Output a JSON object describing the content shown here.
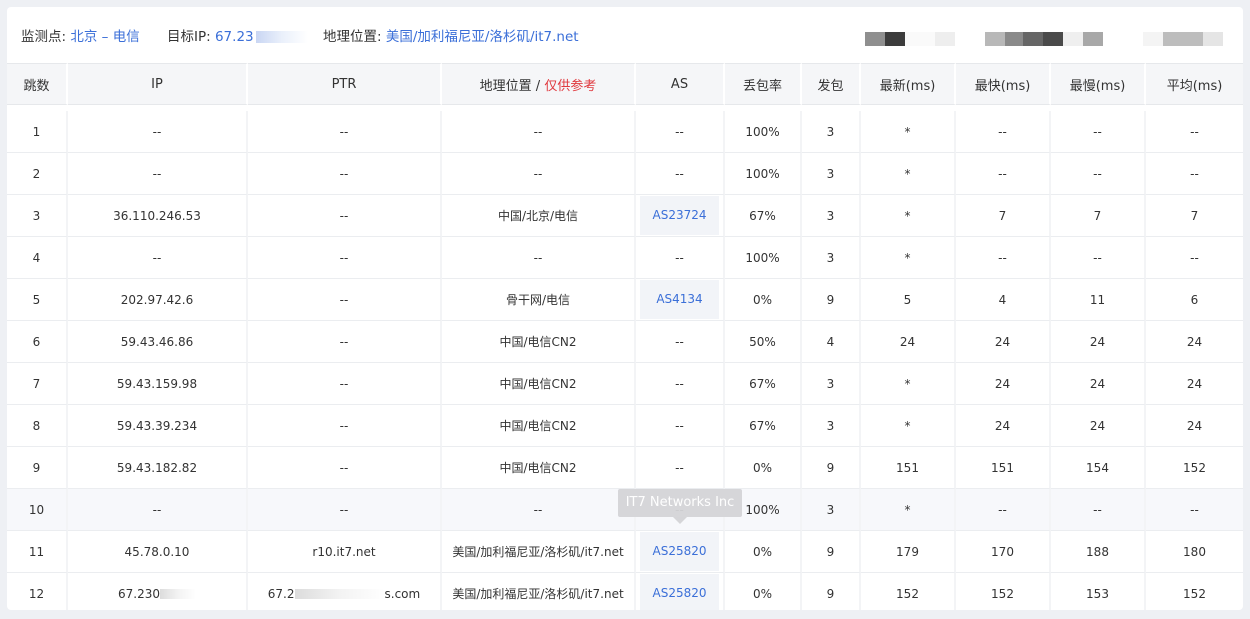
{
  "info": {
    "monitor_label": "监测点:",
    "monitor_value": "北京 – 电信",
    "target_label": "目标IP:",
    "target_value": "67.23",
    "geo_label": "地理位置:",
    "geo_value": "美国/加利福尼亚/洛杉矶/it7.net"
  },
  "table": {
    "headers": {
      "hop": "跳数",
      "ip": "IP",
      "ptr": "PTR",
      "geo": "地理位置",
      "geo_sep": " / ",
      "geo_note": "仅供参考",
      "as": "AS",
      "loss": "丢包率",
      "sent": "发包",
      "latest": "最新(ms)",
      "best": "最快(ms)",
      "worst": "最慢(ms)",
      "avg": "平均(ms)"
    },
    "rows": [
      {
        "hop": "1",
        "ip": "--",
        "ptr": "--",
        "geo": "--",
        "as": "--",
        "loss": "100%",
        "sent": "3",
        "latest": "*",
        "best": "--",
        "worst": "--",
        "avg": "--"
      },
      {
        "hop": "2",
        "ip": "--",
        "ptr": "--",
        "geo": "--",
        "as": "--",
        "loss": "100%",
        "sent": "3",
        "latest": "*",
        "best": "--",
        "worst": "--",
        "avg": "--"
      },
      {
        "hop": "3",
        "ip": "36.110.246.53",
        "ptr": "--",
        "geo": "中国/北京/电信",
        "as": "AS23724",
        "loss": "67%",
        "sent": "3",
        "latest": "*",
        "best": "7",
        "worst": "7",
        "avg": "7"
      },
      {
        "hop": "4",
        "ip": "--",
        "ptr": "--",
        "geo": "--",
        "as": "--",
        "loss": "100%",
        "sent": "3",
        "latest": "*",
        "best": "--",
        "worst": "--",
        "avg": "--"
      },
      {
        "hop": "5",
        "ip": "202.97.42.6",
        "ptr": "--",
        "geo": "骨干网/电信",
        "as": "AS4134",
        "loss": "0%",
        "sent": "9",
        "latest": "5",
        "best": "4",
        "worst": "11",
        "avg": "6"
      },
      {
        "hop": "6",
        "ip": "59.43.46.86",
        "ptr": "--",
        "geo": "中国/电信CN2",
        "as": "--",
        "loss": "50%",
        "sent": "4",
        "latest": "24",
        "best": "24",
        "worst": "24",
        "avg": "24"
      },
      {
        "hop": "7",
        "ip": "59.43.159.98",
        "ptr": "--",
        "geo": "中国/电信CN2",
        "as": "--",
        "loss": "67%",
        "sent": "3",
        "latest": "*",
        "best": "24",
        "worst": "24",
        "avg": "24"
      },
      {
        "hop": "8",
        "ip": "59.43.39.234",
        "ptr": "--",
        "geo": "中国/电信CN2",
        "as": "--",
        "loss": "67%",
        "sent": "3",
        "latest": "*",
        "best": "24",
        "worst": "24",
        "avg": "24"
      },
      {
        "hop": "9",
        "ip": "59.43.182.82",
        "ptr": "--",
        "geo": "中国/电信CN2",
        "as": "--",
        "loss": "0%",
        "sent": "9",
        "latest": "151",
        "best": "151",
        "worst": "154",
        "avg": "152"
      },
      {
        "hop": "10",
        "ip": "--",
        "ptr": "--",
        "geo": "--",
        "as": "--",
        "loss": "100%",
        "sent": "3",
        "latest": "*",
        "best": "--",
        "worst": "--",
        "avg": "--"
      },
      {
        "hop": "11",
        "ip": "45.78.0.10",
        "ptr": "r10.it7.net",
        "geo": "美国/加利福尼亚/洛杉矶/it7.net",
        "as": "AS25820",
        "loss": "0%",
        "sent": "9",
        "latest": "179",
        "best": "170",
        "worst": "188",
        "avg": "180"
      },
      {
        "hop": "12",
        "ip": "67.230",
        "ptr_a": "67.2",
        "ptr_b": "s.com",
        "geo": "美国/加利福尼亚/洛杉矶/it7.net",
        "as": "AS25820",
        "loss": "0%",
        "sent": "9",
        "latest": "152",
        "best": "152",
        "worst": "153",
        "avg": "152"
      }
    ]
  },
  "tooltip": "IT7 Networks Inc",
  "colors": {
    "link": "#3b6fd8",
    "warn": "#e0393e",
    "header_bg": "#f5f6f8",
    "tooltip_bg": "#d5d5d8"
  }
}
